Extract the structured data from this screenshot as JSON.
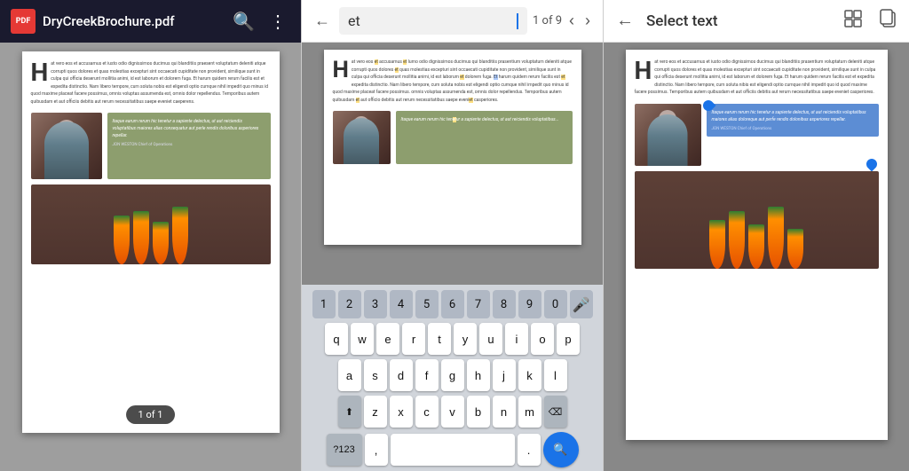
{
  "panel1": {
    "header": {
      "title": "DryCreekBrochure.pdf",
      "search_icon": "🔍",
      "more_icon": "⋮"
    },
    "content": {
      "drop_cap": "H",
      "body_text": "at vero eos et accusamus et iusto odio dignissimos ducimus qui blanditiis praesent voluptatum deleniti atque corrupti quos dolores et quas molestias excepturi sint occaecati cupiditate non provident, similique sunt in culpa qui officia deserunt mollitia animi, id est laborum et dolorem fuga. Et harum quidem rerum facilis est et expedita distinctio. Nam libero tempore, cum soluta nobis est eligendi optio cumque nihil impedit quo minus id quod maxime placeat facere possimus, omnis voluptas assumenda est, omnis dolor repellendus. Temporibus autem quibusdam et aut officiis debitis aut rerum necessitatibus saepe eveniet caeperens.",
      "quote_text": "Itaque earum rerum hic tenetur a sapiente delectus, ut aut reiciendis voluptatibus maiores alias consequatur aut perle rendis doloribus asperiores repellar.",
      "quote_author": "JON WESTON  Chief of Operations",
      "page_badge": "1 of 1"
    }
  },
  "panel2": {
    "header": {
      "back_icon": "←",
      "search_text": "et",
      "page_indicator": "1 of 9",
      "of_text": "of 9",
      "prev_icon": "‹",
      "next_icon": "›"
    },
    "content": {
      "drop_cap": "H",
      "body_text": "at vero eos et accusamus et lumo odio dignissimos ducimus qui blanditiis prasentium voluptatum deleniti atque corrupti quos dolores et quas molestias excepturi sint occaecati cupiditate non provident, similique sunt in culpa qui officia deserunt mollitia animi, id est laborum et dolorem fuga. Et harum quidem rerum facilis est et expedita distinctio. Nam libero tempore, cum soluta nobis est eligendi optio cumque nihil impedit quo minus id quod maxime placeat facere possimus. omnis voluptas assumenda est, omnis dolor repellendus. Temporibus autem quibusdam et aut officio debitis aut rerum necessitatibus saepe eveniet casperiores.",
      "quote_text": "Itaque earum rerum hic tenetur a sapiente delectus, ut aut reiciendis voluptatibus..."
    },
    "keyboard": {
      "num_row": [
        "1",
        "2",
        "3",
        "4",
        "5",
        "6",
        "7",
        "8",
        "9",
        "0"
      ],
      "row1": [
        "q",
        "w",
        "e",
        "r",
        "t",
        "y",
        "u",
        "i",
        "o",
        "p"
      ],
      "row2": [
        "a",
        "s",
        "d",
        "f",
        "g",
        "h",
        "j",
        "k",
        "l"
      ],
      "row3": [
        "z",
        "x",
        "c",
        "v",
        "b",
        "n",
        "m"
      ],
      "special_left": "⬆",
      "delete": "⌫",
      "bottom_left": "?123",
      "comma": ",",
      "space": "",
      "period": ".",
      "search": "🔍"
    }
  },
  "panel3": {
    "header": {
      "back_icon": "←",
      "title": "Select text",
      "grid_icon": "⊞",
      "copy_icon": "⧉"
    },
    "content": {
      "drop_cap": "H",
      "body_text": "at vero eos et accusamus et iusto odio dignissimos ducimus qui blanditiis prasentium voluptatum deleniti atque corrupti quos dolores et quas molestias excepturi sint occaecati cupiditate non provident, similique sunt in culpa qui officia deserunt mollitia animi, id est laborum et dolorem fuga. Et harum quidem rerum facilis est et expedita distinctio. Nam libero tempore, cum soluta nibis est eligendi optio cumque nihil impedit quo id quod maxime facere possimus. Temporibus autem quibusdam et aut officiis debitis aut rerum necessitatibus saepe eveniet casperiores.",
      "quote_selected": "Itaque earum rerum hic tenetur a sapiente delectus, ut aut reiciendis voluptatibus maiores alias doloreque aut perfe rendis dolonibus asperiores repellar.",
      "quote_author": "JON WESTON  Chief of Operations"
    }
  }
}
